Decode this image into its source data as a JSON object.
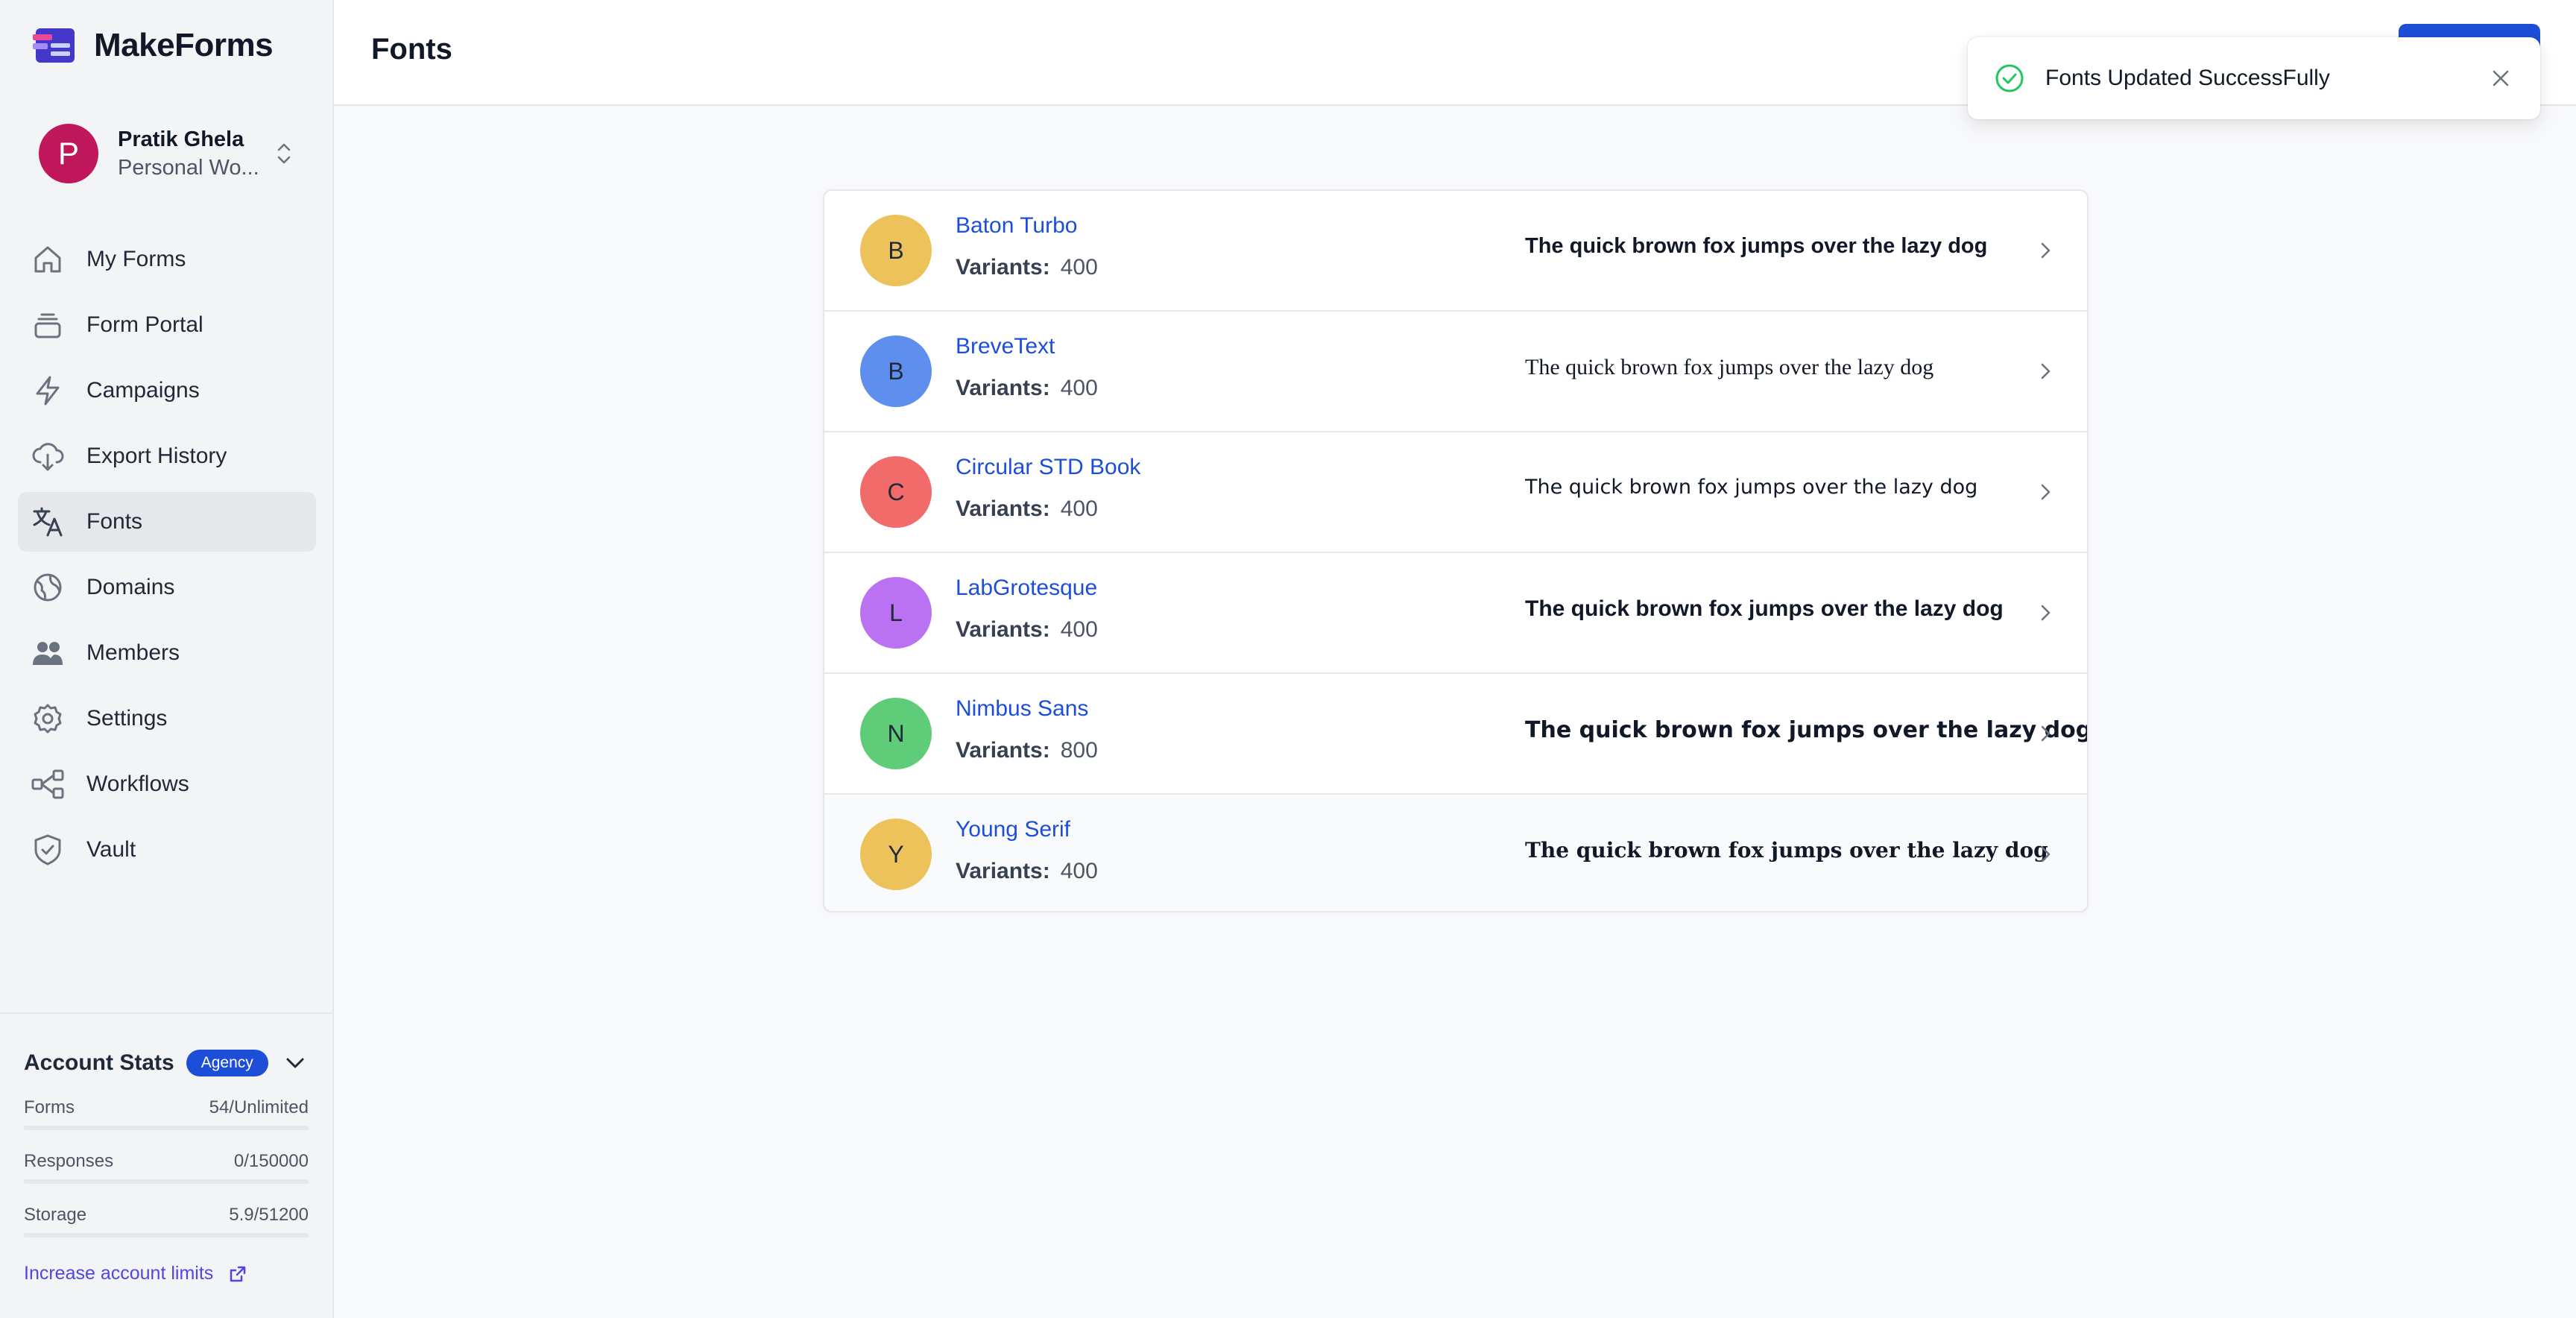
{
  "app": {
    "name": "MakeForms"
  },
  "workspace": {
    "initial": "P",
    "name": "Pratik Ghela",
    "subtitle": "Personal Wo..."
  },
  "nav": {
    "items": [
      {
        "label": "My Forms",
        "icon": "home-icon",
        "active": false
      },
      {
        "label": "Form Portal",
        "icon": "stack-icon",
        "active": false
      },
      {
        "label": "Campaigns",
        "icon": "lightning-icon",
        "active": false
      },
      {
        "label": "Export History",
        "icon": "cloud-download-icon",
        "active": false
      },
      {
        "label": "Fonts",
        "icon": "translate-icon",
        "active": true
      },
      {
        "label": "Domains",
        "icon": "globe-icon",
        "active": false
      },
      {
        "label": "Members",
        "icon": "users-icon",
        "active": false
      },
      {
        "label": "Settings",
        "icon": "gear-icon",
        "active": false
      },
      {
        "label": "Workflows",
        "icon": "workflow-icon",
        "active": false
      },
      {
        "label": "Vault",
        "icon": "shield-icon",
        "active": false
      }
    ]
  },
  "account_stats": {
    "title": "Account Stats",
    "badge": "Agency",
    "stats": [
      {
        "label": "Forms",
        "value": "54/Unlimited"
      },
      {
        "label": "Responses",
        "value": "0/150000"
      },
      {
        "label": "Storage",
        "value": "5.9/51200"
      }
    ],
    "increase_link": "Increase account limits"
  },
  "header": {
    "title": "Fonts"
  },
  "toast": {
    "message": "Fonts Updated SuccessFully"
  },
  "fonts": {
    "variants_label": "Variants:",
    "sample_text": "The quick brown fox jumps over the lazy dog",
    "items": [
      {
        "initial": "B",
        "name": "Baton Turbo",
        "variants": "400",
        "color": "#eec25a"
      },
      {
        "initial": "B",
        "name": "BreveText",
        "variants": "400",
        "color": "#5f8fee"
      },
      {
        "initial": "C",
        "name": "Circular STD Book",
        "variants": "400",
        "color": "#f26b6b"
      },
      {
        "initial": "L",
        "name": "LabGrotesque",
        "variants": "400",
        "color": "#bb72f2"
      },
      {
        "initial": "N",
        "name": "Nimbus Sans",
        "variants": "800",
        "color": "#5fcc7a"
      },
      {
        "initial": "Y",
        "name": "Young Serif",
        "variants": "400",
        "color": "#eec25a"
      }
    ]
  },
  "colors": {
    "accent": "#1d4ed8",
    "active_nav": "#e5e7eb",
    "success": "#22c55e"
  }
}
